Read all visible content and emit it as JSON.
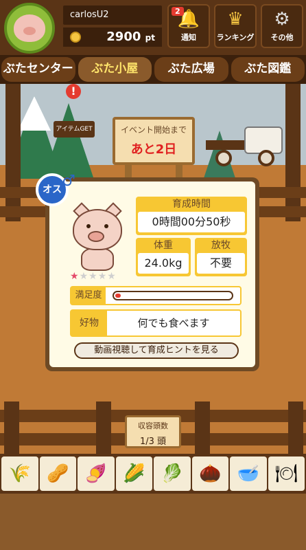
{
  "header": {
    "username": "carlosU2",
    "points_value": "2900",
    "points_unit": "pt",
    "notification_badge": "2",
    "buttons": [
      {
        "label": "通知",
        "icon": "bell-icon"
      },
      {
        "label": "ランキング",
        "icon": "crown-icon"
      },
      {
        "label": "その他",
        "icon": "gear-icon"
      }
    ]
  },
  "tabs": [
    {
      "label": "ぶたセンター",
      "active": false
    },
    {
      "label": "ぶた小屋",
      "active": true
    },
    {
      "label": "ぶた広場",
      "active": false
    },
    {
      "label": "ぶた図鑑",
      "active": false
    }
  ],
  "scene": {
    "item_flag": "アイテムGET",
    "item_alert": "!",
    "event_sign_line1": "イベント開始まで",
    "event_sign_line2": "あと2日"
  },
  "pig_info": {
    "gender_label": "オス",
    "stars_total": 5,
    "stars_filled": 1,
    "growth_time_label": "育成時間",
    "growth_time_value": "0時間00分50秒",
    "weight_label": "体重",
    "weight_value": "24.0kg",
    "graze_label": "放牧",
    "graze_value": "不要",
    "satisfaction_label": "満足度",
    "satisfaction_level": 0.04,
    "preference_label": "好物",
    "preference_value": "何でも食べます",
    "hint_button": "動画視聴して育成ヒントを見る"
  },
  "capacity": {
    "label": "収容頭数",
    "value": "1/3 頭"
  },
  "foods": [
    {
      "icon": "grain-icon"
    },
    {
      "icon": "mixed-grain-icon"
    },
    {
      "icon": "sweet-potato-icon"
    },
    {
      "icon": "corn-icon"
    },
    {
      "icon": "vegetables-icon"
    },
    {
      "icon": "acorn-icon"
    },
    {
      "icon": "bean-bowl-icon"
    },
    {
      "icon": "meal-plate-icon"
    }
  ]
}
